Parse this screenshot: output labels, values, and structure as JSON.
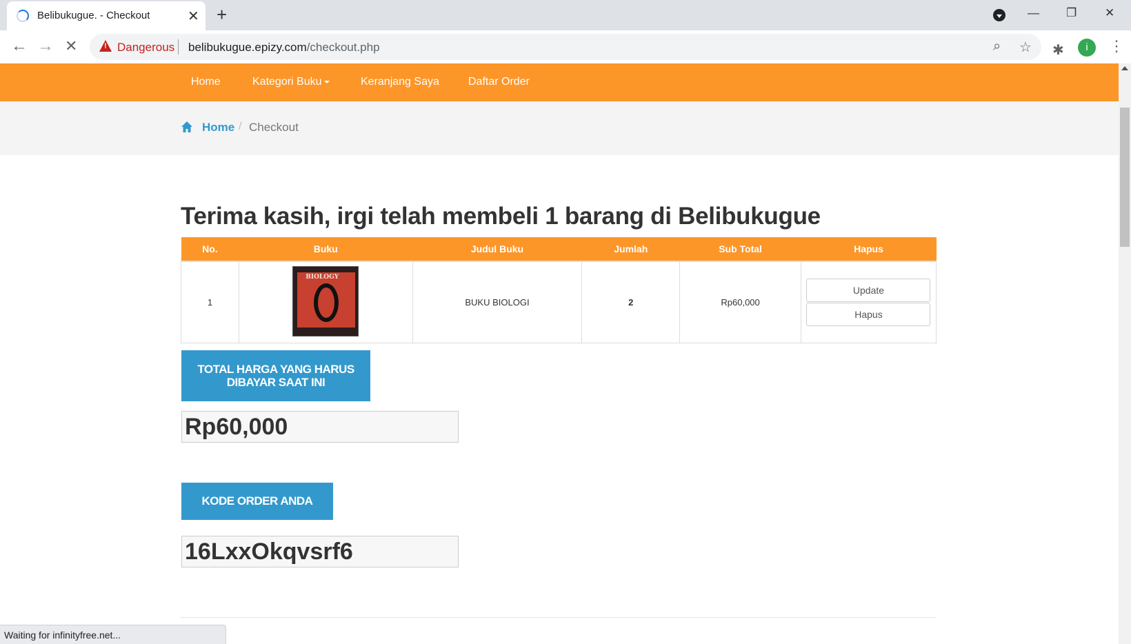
{
  "browser": {
    "tab_title": "Belibukugue. - Checkout",
    "tab_close": "✕",
    "new_tab": "+",
    "security_label": "Dangerous",
    "url_domain": "belibukugue.epizy.com",
    "url_path": "/checkout.php",
    "back": "←",
    "forward": "→",
    "stop": "✕",
    "zoom_icon": "⌕",
    "star_icon": "☆",
    "extensions_icon": "✱",
    "profile_initial": "i",
    "menu_icon": "⋮",
    "minimize": "—",
    "restore": "❐",
    "close": "✕",
    "status_text": "Waiting for infinityfree.net..."
  },
  "nav": {
    "home": "Home",
    "kategori": "Kategori Buku",
    "keranjang": "Keranjang Saya",
    "daftar_order": "Daftar Order"
  },
  "breadcrumb": {
    "home": "Home",
    "separator": "/",
    "current": "Checkout"
  },
  "heading": "Terima kasih, irgi telah membeli 1 barang di Belibukugue",
  "cart": {
    "headers": [
      "No.",
      "Buku",
      "Judul Buku",
      "Jumlah",
      "Sub Total",
      "Hapus"
    ],
    "rows": [
      {
        "no": "1",
        "cover_text": "BIOLOGY",
        "title": "BUKU BIOLOGI",
        "qty": "2",
        "subtotal": "Rp60,000",
        "update_label": "Update",
        "delete_label": "Hapus"
      }
    ]
  },
  "total": {
    "label_line1": "TOTAL HARGA YANG HARUS",
    "label_line2": "DIBAYAR SAAT INI",
    "value": "Rp60,000"
  },
  "order": {
    "label": "KODE ORDER ANDA",
    "value": "16LxxOkqvsrf6"
  },
  "colors": {
    "nav_orange": "#fd9628",
    "label_blue": "#3399cc",
    "danger_red": "#c5221f"
  }
}
